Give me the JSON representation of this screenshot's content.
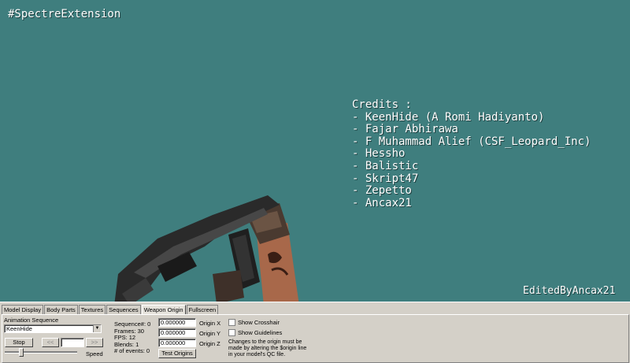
{
  "viewport": {
    "tag": "#SpectreExtension",
    "credits": [
      "Credits :",
      "- KeenHide (A Romi Hadiyanto)",
      "- Fajar Abhirawa",
      "- F Muhammad Alief (CSF_Leopard_Inc)",
      "- Hessho",
      "- Balistic",
      "- Skript47",
      "- Zepetto",
      "- Ancax21"
    ],
    "edited_by": "EditedByAncax21",
    "background_color": "#3f7e7e"
  },
  "tabs": [
    {
      "label": "Model Display",
      "active": false
    },
    {
      "label": "Body Parts",
      "active": false
    },
    {
      "label": "Textures",
      "active": false
    },
    {
      "label": "Sequences",
      "active": false
    },
    {
      "label": "Weapon Origin",
      "active": true
    },
    {
      "label": "Fullscreen",
      "active": false
    }
  ],
  "animation": {
    "label": "Animation Sequence",
    "selected": "KeenHide",
    "stop_label": "Stop",
    "prev_label": "<<",
    "next_label": ">>",
    "speed_label": "Speed"
  },
  "stats": {
    "sequence": "Sequence#: 0",
    "frames": "Frames: 30",
    "fps": "FPS: 12",
    "blends": "Blends: 1",
    "events": "# of events: 0"
  },
  "origin": {
    "x_value": "0.000000",
    "y_value": "0.000000",
    "z_value": "0.000000",
    "x_label": "Origin X",
    "y_label": "Origin Y",
    "z_label": "Origin Z",
    "test_label": "Test Origins"
  },
  "options": {
    "crosshair_label": "Show Crosshair",
    "guidelines_label": "Show Guidelines",
    "note": [
      "Changes to the origin must be",
      "made by altering the $origin line",
      "in your model's QC file."
    ]
  }
}
